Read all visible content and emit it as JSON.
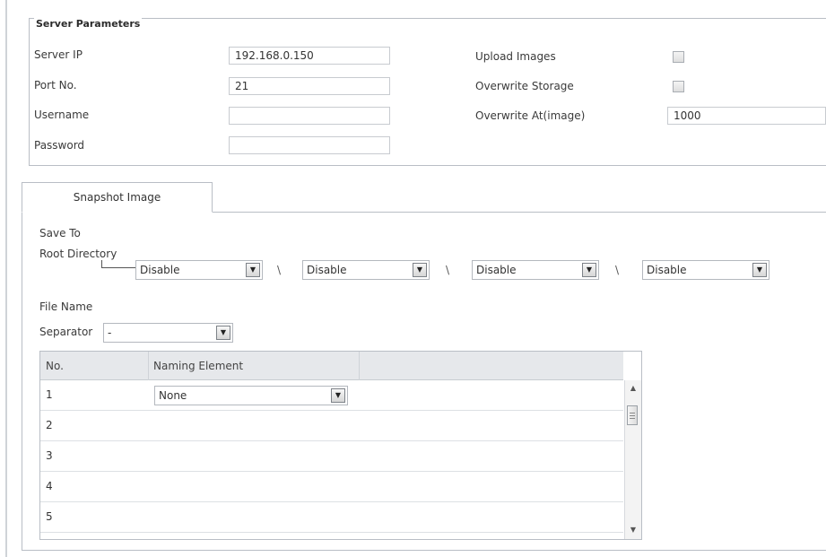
{
  "server_parameters": {
    "title": "Server Parameters",
    "server_ip": {
      "label": "Server IP",
      "value": "192.168.0.150"
    },
    "port_no": {
      "label": "Port No.",
      "value": "21"
    },
    "username": {
      "label": "Username",
      "value": ""
    },
    "password": {
      "label": "Password",
      "value": ""
    },
    "upload_images": {
      "label": "Upload Images",
      "checked": false
    },
    "overwrite_storage": {
      "label": "Overwrite Storage",
      "checked": false
    },
    "overwrite_at": {
      "label": "Overwrite At(image)",
      "value": "1000"
    }
  },
  "tab": {
    "label": "Snapshot Image"
  },
  "save_to": {
    "label": "Save To",
    "root_directory_label": "Root Directory",
    "path_separator": "\\",
    "dropdowns": [
      "Disable",
      "Disable",
      "Disable",
      "Disable"
    ]
  },
  "file_name": {
    "label": "File Name",
    "separator_label": "Separator",
    "separator_value": "-"
  },
  "naming_table": {
    "columns": [
      "No.",
      "Naming Element"
    ],
    "rows": [
      {
        "no": "1",
        "element": "None"
      },
      {
        "no": "2",
        "element": ""
      },
      {
        "no": "3",
        "element": ""
      },
      {
        "no": "4",
        "element": ""
      },
      {
        "no": "5",
        "element": ""
      }
    ]
  },
  "icons": {
    "dropdown_arrow": "dropdown-arrow-icon",
    "scroll_up": "scroll-up-icon",
    "scroll_down": "scroll-down-icon"
  }
}
